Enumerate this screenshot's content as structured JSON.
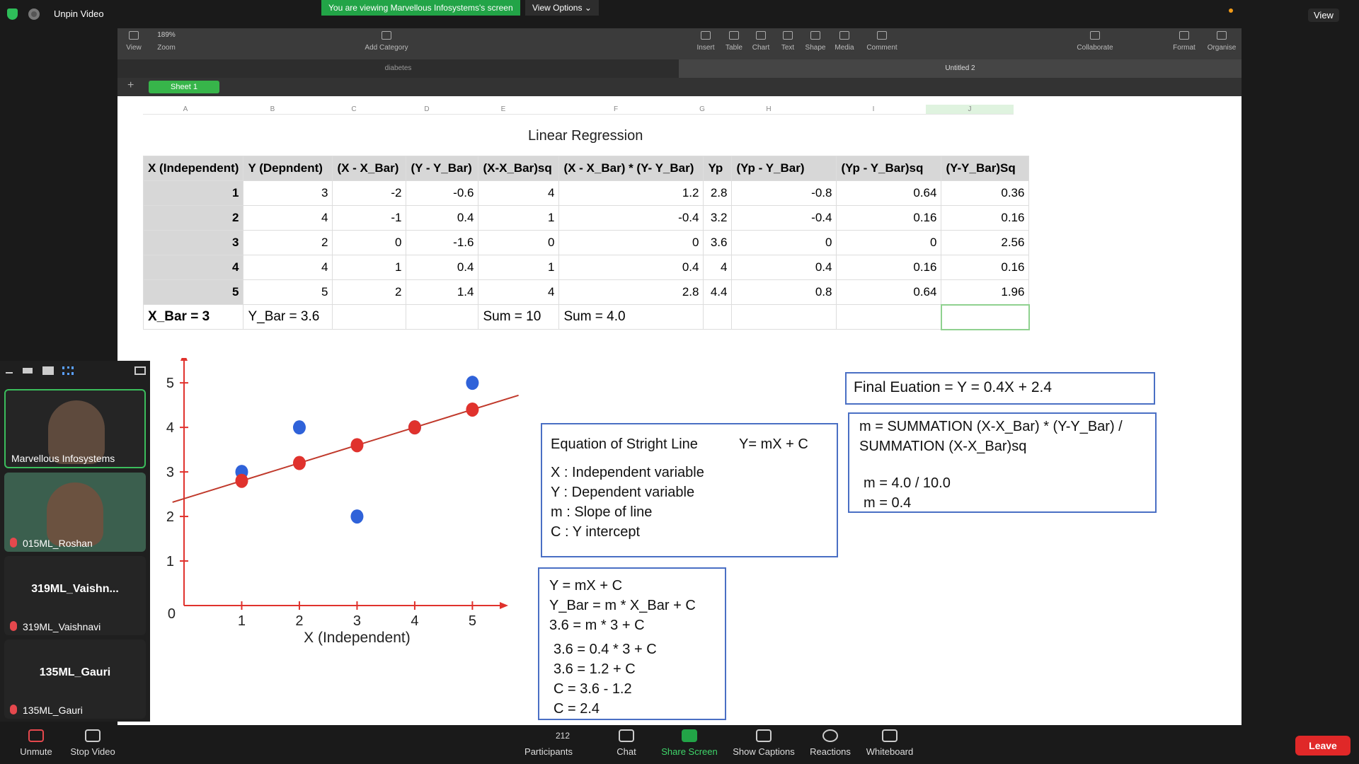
{
  "zoom": {
    "unpin": "Unpin Video",
    "banner": "You are viewing Marvellous Infosystems's screen",
    "view_options": "View Options ⌄",
    "view": "View",
    "bottom": [
      "Unmute",
      "Stop Video",
      "212",
      "Participants",
      "Chat",
      "Share Screen",
      "Show Captions",
      "Reactions",
      "Whiteboard"
    ],
    "leave": "Leave"
  },
  "numbers": {
    "toolbar": [
      "View",
      "Zoom",
      "189%",
      "Add Category",
      "Insert",
      "Table",
      "Chart",
      "Text",
      "Shape",
      "Media",
      "Comment",
      "Collaborate",
      "Format",
      "Organise"
    ],
    "doc_left": "diabetes",
    "doc_right": "Untitled 2",
    "sheet": "Sheet 1",
    "columns": [
      "A",
      "B",
      "C",
      "D",
      "E",
      "F",
      "G",
      "H",
      "I",
      "J"
    ]
  },
  "sheet_title": "Linear Regression",
  "table": {
    "headers": [
      "X (Independent)",
      "Y (Depndent)",
      "(X - X_Bar)",
      "(Y - Y_Bar)",
      "(X-X_Bar)sq",
      "(X - X_Bar) * (Y- Y_Bar)",
      "Yp",
      "(Yp - Y_Bar)",
      "(Yp - Y_Bar)sq",
      "(Y-Y_Bar)Sq"
    ],
    "rows": [
      [
        "1",
        "3",
        "-2",
        "-0.6",
        "4",
        "1.2",
        "2.8",
        "-0.8",
        "0.64",
        "0.36"
      ],
      [
        "2",
        "4",
        "-1",
        "0.4",
        "1",
        "-0.4",
        "3.2",
        "-0.4",
        "0.16",
        "0.16"
      ],
      [
        "3",
        "2",
        "0",
        "-1.6",
        "0",
        "0",
        "3.6",
        "0",
        "0",
        "2.56"
      ],
      [
        "4",
        "4",
        "1",
        "0.4",
        "1",
        "0.4",
        "4",
        "0.4",
        "0.16",
        "0.16"
      ],
      [
        "5",
        "5",
        "2",
        "1.4",
        "4",
        "2.8",
        "4.4",
        "0.8",
        "0.64",
        "1.96"
      ]
    ],
    "footer": [
      "X_Bar = 3",
      "Y_Bar = 3.6",
      "",
      "",
      "Sum = 10",
      "Sum = 4.0",
      "",
      "",
      "",
      ""
    ]
  },
  "chart_data": {
    "type": "scatter",
    "xlabel": "X (Independent)",
    "x_ticks": [
      "1",
      "2",
      "3",
      "4",
      "5"
    ],
    "y_ticks": [
      "1",
      "2",
      "3",
      "4",
      "5"
    ],
    "origin_label": "0",
    "xlim": [
      0,
      5.4
    ],
    "ylim": [
      0,
      5.4
    ],
    "series": [
      {
        "values": [
          [
            1,
            3
          ],
          [
            2,
            4
          ],
          [
            3,
            2
          ],
          [
            4,
            4
          ],
          [
            5,
            5
          ]
        ],
        "color": "#2f62d9"
      },
      {
        "values": [
          [
            1,
            2.8
          ],
          [
            2,
            3.2
          ],
          [
            3,
            3.6
          ],
          [
            4,
            4
          ],
          [
            5,
            4.4
          ]
        ],
        "color": "#e0322d"
      }
    ],
    "line": {
      "slope": 0.4,
      "intercept": 2.4,
      "color": "#c0392b"
    },
    "axis_color": "#e0322d"
  },
  "boxes": {
    "final": "Final Euation = Y = 0.4X + 2.4",
    "m_formula": "m = SUMMATION (X-X_Bar) * (Y-Y_Bar) /",
    "m_formula2": "SUMMATION (X-X_Bar)sq",
    "m_calc": [
      "m = 4.0 / 10.0",
      "m = 0.4"
    ],
    "line_title": "Equation of Stright Line",
    "line_eq": "Y= mX + C",
    "vars": [
      "X  : Independent variable",
      "Y  : Dependent variable",
      "m : Slope of line",
      "C  : Y intercept"
    ],
    "solve": [
      "Y = mX + C",
      "Y_Bar = m * X_Bar + C",
      "3.6 = m * 3 + C"
    ],
    "solve2": [
      "3.6 = 0.4 * 3 + C",
      "3.6 = 1.2 + C",
      "C = 3.6 - 1.2",
      "C = 2.4"
    ]
  },
  "participants": [
    {
      "name": "Marvellous Infosystems"
    },
    {
      "name": "015ML_Roshan"
    },
    {
      "name": "319ML_Vaishnavi",
      "display": "319ML_Vaishn..."
    },
    {
      "name": "135ML_Gauri",
      "display": "135ML_Gauri"
    }
  ]
}
